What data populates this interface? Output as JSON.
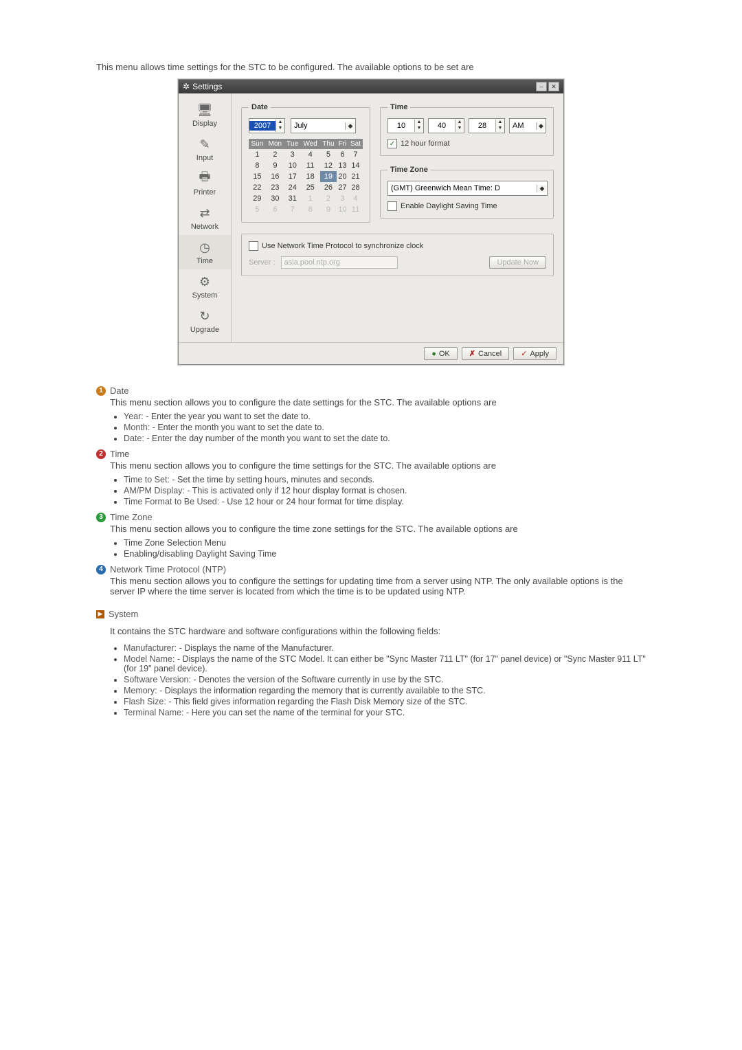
{
  "intro": "This menu allows time settings for the STC to be configured. The available options to be set are",
  "settings_window": {
    "title": "Settings",
    "sidebar": [
      {
        "label": "Display",
        "icon": "🖥"
      },
      {
        "label": "Input",
        "icon": "✎"
      },
      {
        "label": "Printer",
        "icon": "🖶"
      },
      {
        "label": "Network",
        "icon": "⇄"
      },
      {
        "label": "Time",
        "icon": "◷"
      },
      {
        "label": "System",
        "icon": "⚙"
      },
      {
        "label": "Upgrade",
        "icon": "↻"
      }
    ],
    "date": {
      "legend": "Date",
      "year": "2007",
      "month": "July",
      "dow": [
        "Sun",
        "Mon",
        "Tue",
        "Wed",
        "Thu",
        "Fri",
        "Sat"
      ],
      "selected_day": "19"
    },
    "time": {
      "legend": "Time",
      "hh": "10",
      "mm": "40",
      "ss": "28",
      "ampm": "AM",
      "fmt_checked": true,
      "fmt_label": "12 hour format"
    },
    "timezone": {
      "legend": "Time Zone",
      "value": "(GMT) Greenwich Mean Time: D",
      "dst_checked": false,
      "dst_label": "Enable Daylight Saving Time"
    },
    "ntp": {
      "use_checked": false,
      "use_label": "Use Network Time Protocol to synchronize clock",
      "server_label": "Server :",
      "server_value": "asia.pool.ntp.org",
      "update_btn": "Update Now"
    },
    "footer": {
      "ok": "OK",
      "cancel": "Cancel",
      "apply": "Apply"
    }
  },
  "blocks": [
    {
      "num": "1",
      "color": "c1",
      "title": "Date",
      "desc": "This menu section allows you to configure the date settings for the STC. The available options are",
      "items": [
        {
          "lbl": "Year:",
          "txt": " - Enter the year you want to set the date to."
        },
        {
          "lbl": "Month:",
          "txt": " - Enter the month you want to set the date to."
        },
        {
          "lbl": "Date:",
          "txt": " - Enter the day number of the month you want to set the date to."
        }
      ]
    },
    {
      "num": "2",
      "color": "c2",
      "title": "Time",
      "desc": "This menu section allows you to configure the time settings for the STC. The available options are",
      "items": [
        {
          "lbl": "Time to Set:",
          "txt": " - Set the time by setting hours, minutes and seconds."
        },
        {
          "lbl": "AM/PM Display:",
          "txt": " - This is activated only if 12 hour display format is chosen."
        },
        {
          "lbl": "Time Format to Be Used:",
          "txt": " - Use 12 hour or 24 hour format for time display."
        }
      ]
    },
    {
      "num": "3",
      "color": "c3",
      "title": "Time Zone",
      "desc": "This menu section allows you to configure the time zone settings for the STC. The available options are",
      "items": [
        {
          "lbl": "",
          "txt": "Time Zone Selection Menu"
        },
        {
          "lbl": "",
          "txt": "Enabling/disabling Daylight Saving Time"
        }
      ]
    },
    {
      "num": "4",
      "color": "c4",
      "title": "Network Time Protocol (NTP)",
      "desc": "This menu section allows you to configure the settings for updating time from a server using NTP. The only available options is the server IP where the time server is located from which the time is to be updated using NTP.",
      "items": []
    }
  ],
  "system": {
    "title": "System",
    "desc": "It contains the STC hardware and software configurations within the following fields:",
    "items": [
      {
        "lbl": "Manufacturer:",
        "txt": " - Displays the name of the Manufacturer."
      },
      {
        "lbl": "Model Name:",
        "txt": " - Displays the name of the STC Model. It can either be \"Sync Master 711 LT\" (for 17\" panel device) or \"Sync Master 911 LT\" (for 19\" panel device)."
      },
      {
        "lbl": "Software Version:",
        "txt": " - Denotes the version of the Software currently in use by the STC."
      },
      {
        "lbl": "Memory:",
        "txt": " - Displays the information regarding the memory that is currently available to the STC."
      },
      {
        "lbl": "Flash Size:",
        "txt": " - This field gives information regarding the Flash Disk Memory size of the STC."
      },
      {
        "lbl": "Terminal Name:",
        "txt": " - Here you can set the name of the terminal for your STC."
      }
    ]
  }
}
